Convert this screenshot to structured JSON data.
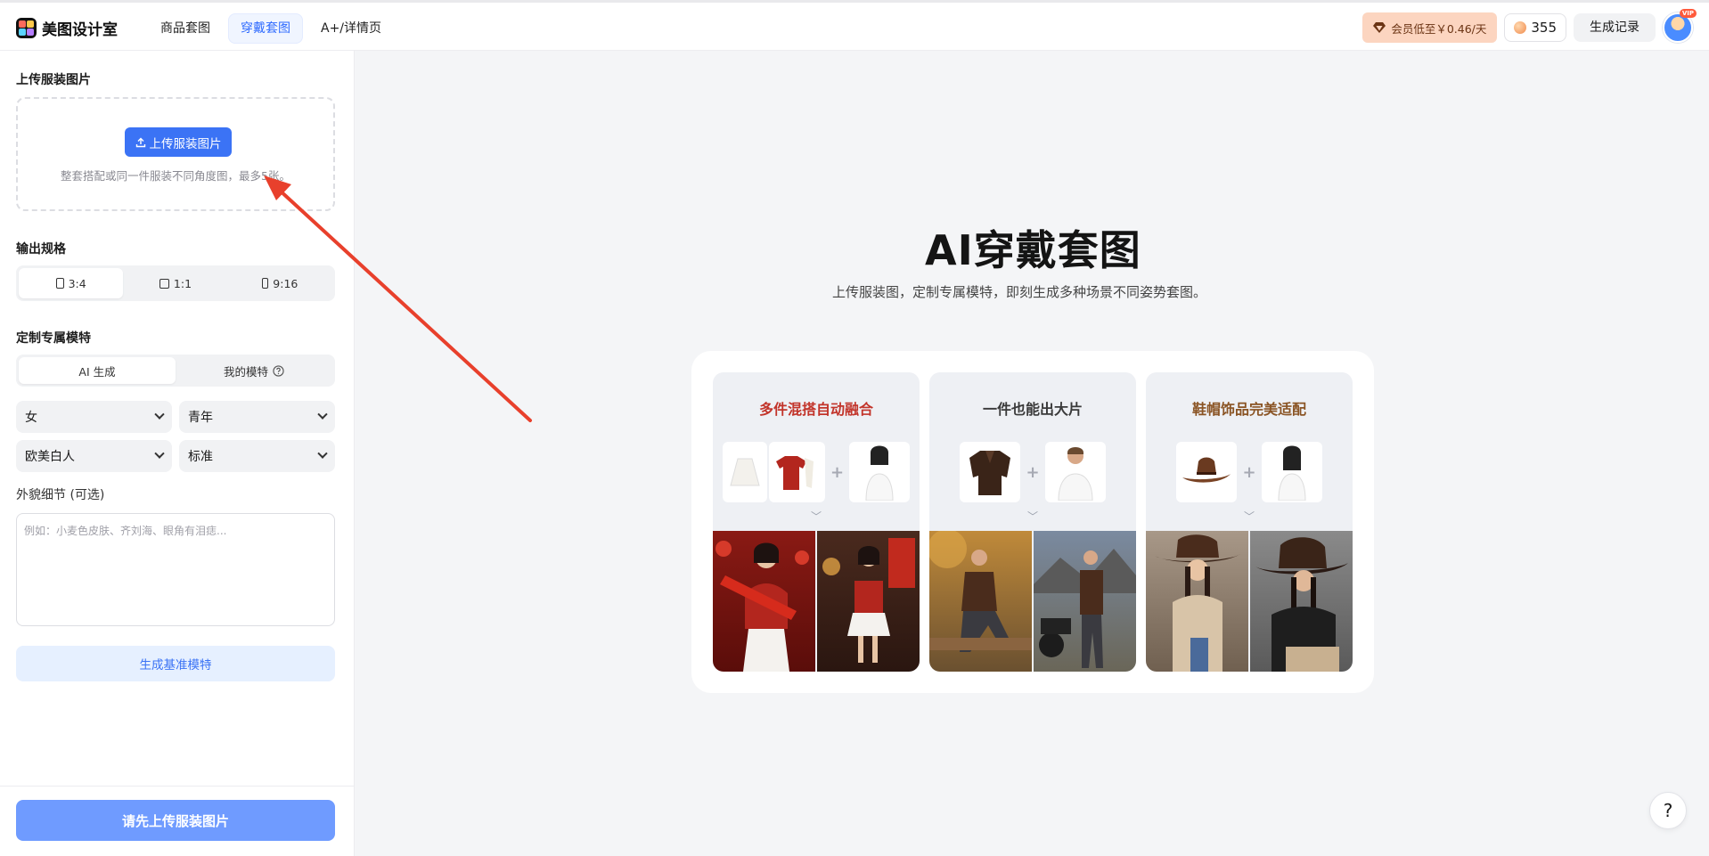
{
  "header": {
    "brand": "美图设计室",
    "nav_tabs": [
      {
        "label": "商品套图"
      },
      {
        "label": "穿戴套图"
      },
      {
        "label": "A+/详情页"
      }
    ],
    "vip_label": "会员低至￥0.46/天",
    "credits": "355",
    "history_label": "生成记录",
    "avatar_badge": "VIP"
  },
  "sidebar": {
    "upload_title": "上传服装图片",
    "upload_button": "上传服装图片",
    "upload_hint": "整套搭配或同一件服装不同角度图，最多5张。",
    "output_title": "输出规格",
    "ratios": [
      "3:4",
      "1:1",
      "9:16"
    ],
    "model_title": "定制专属模特",
    "model_tabs": [
      "AI 生成",
      "我的模特"
    ],
    "gender": "女",
    "age": "青年",
    "ethnicity": "欧美白人",
    "body": "标准",
    "detail_label": "外貌细节 (可选)",
    "detail_placeholder": "例如：小麦色皮肤、齐刘海、眼角有泪痣...",
    "gen_model_button": "生成基准模特",
    "submit_button": "请先上传服装图片"
  },
  "main": {
    "title": "AI穿戴套图",
    "subtitle": "上传服装图，定制专属模特，即刻生成多种场景不同姿势套图。",
    "cards": [
      {
        "title": "多件混搭自动融合",
        "color": "#c2342a"
      },
      {
        "title": "一件也能出大片",
        "color": "#3a3a3a"
      },
      {
        "title": "鞋帽饰品完美适配",
        "color": "#8a5424"
      }
    ]
  },
  "colors": {
    "accent": "#3b73f5",
    "accent_soft": "#e6f0ff",
    "submit_disabled": "#6f9bff",
    "vip_bg": "#fcd5c0",
    "annotation_arrow": "#e8402c"
  }
}
